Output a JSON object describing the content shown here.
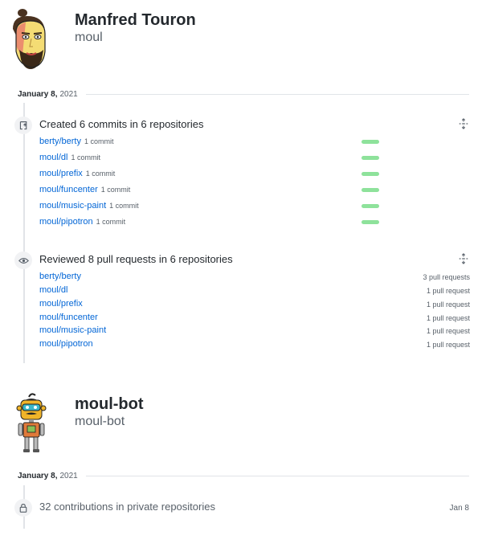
{
  "user1": {
    "name": "Manfred Touron",
    "login": "moul",
    "date_bold": "January 8,",
    "date_year": "2021",
    "commits": {
      "title": "Created 6 commits in 6 repositories",
      "rows": [
        {
          "repo": "berty/berty",
          "count": "1 commit",
          "fraction": 0.17
        },
        {
          "repo": "moul/dl",
          "count": "1 commit",
          "fraction": 0.17
        },
        {
          "repo": "moul/prefix",
          "count": "1 commit",
          "fraction": 0.17
        },
        {
          "repo": "moul/funcenter",
          "count": "1 commit",
          "fraction": 0.17
        },
        {
          "repo": "moul/music-paint",
          "count": "1 commit",
          "fraction": 0.17
        },
        {
          "repo": "moul/pipotron",
          "count": "1 commit",
          "fraction": 0.17
        }
      ]
    },
    "reviews": {
      "title": "Reviewed 8 pull requests in 6 repositories",
      "rows": [
        {
          "repo": "berty/berty",
          "count": "3 pull requests"
        },
        {
          "repo": "moul/dl",
          "count": "1 pull request"
        },
        {
          "repo": "moul/prefix",
          "count": "1 pull request"
        },
        {
          "repo": "moul/funcenter",
          "count": "1 pull request"
        },
        {
          "repo": "moul/music-paint",
          "count": "1 pull request"
        },
        {
          "repo": "moul/pipotron",
          "count": "1 pull request"
        }
      ]
    }
  },
  "user2": {
    "name": "moul-bot",
    "login": "moul-bot",
    "date_bold": "January 8,",
    "date_year": "2021",
    "private": {
      "text": "32 contributions in private repositories",
      "date": "Jan 8"
    }
  },
  "icons": {
    "commit": "repo-push-icon",
    "review": "eye-icon",
    "private": "lock-icon",
    "expand": "unfold-icon"
  },
  "colors": {
    "link": "#0366d6",
    "bar": "#8ee29b",
    "muted": "#586069"
  }
}
